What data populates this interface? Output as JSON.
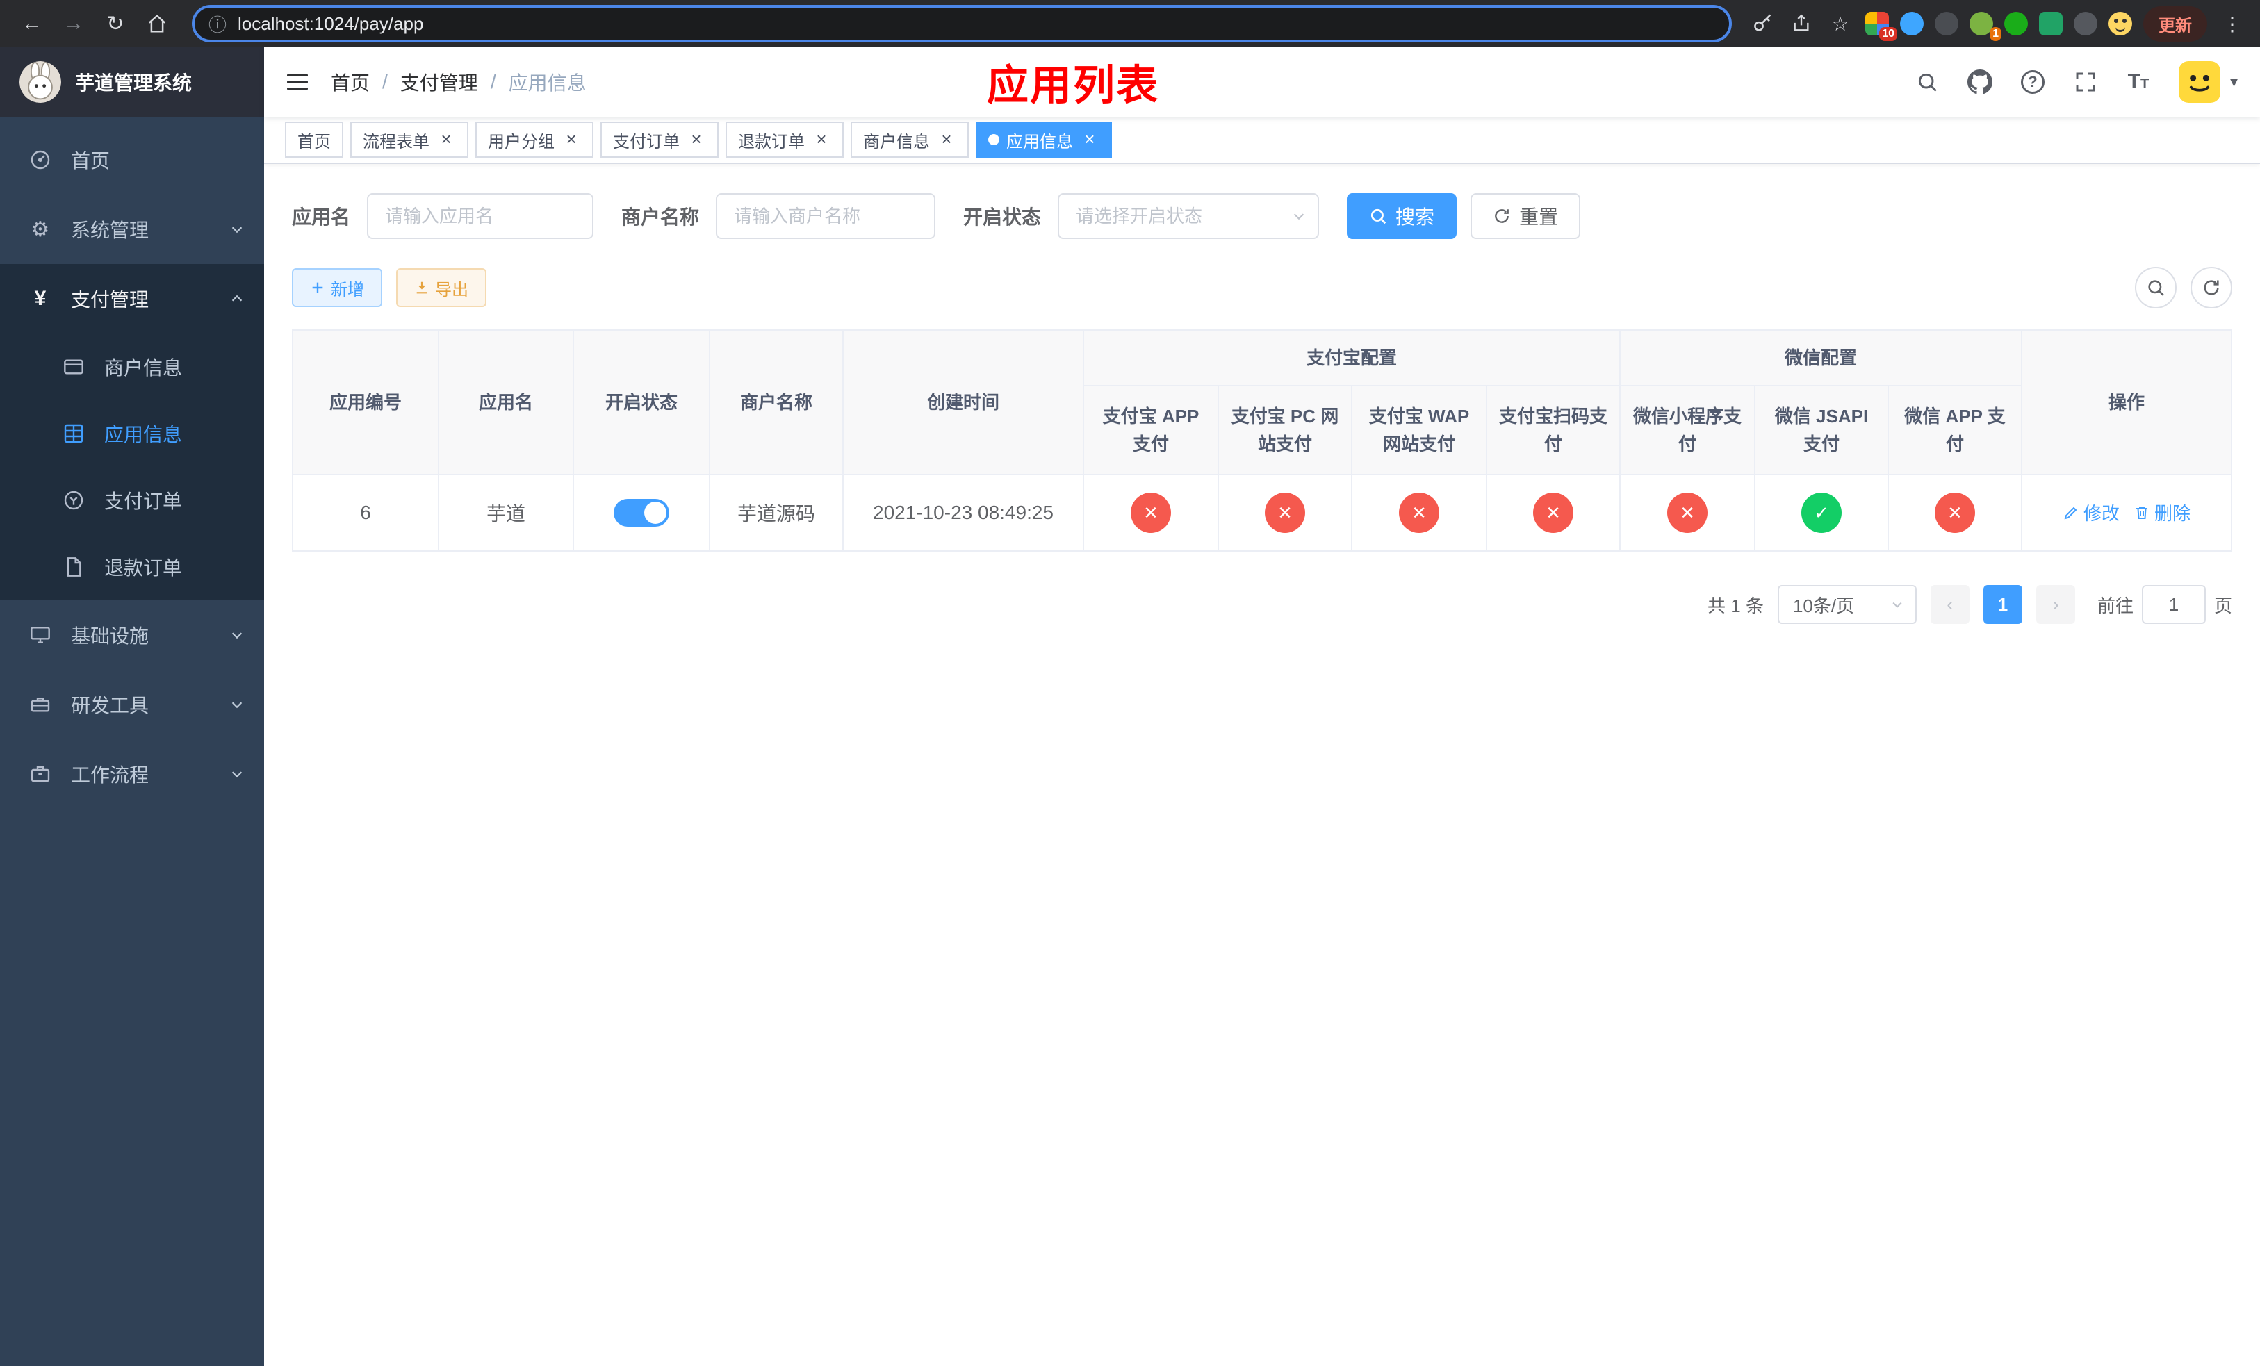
{
  "colors": {
    "primary": "#409eff",
    "danger": "#f5594e",
    "success": "#13ce66",
    "sidebar": "#304156",
    "submenu": "#1f2d3d"
  },
  "browser": {
    "url": "localhost:1024/pay/app",
    "update_label": "更新",
    "ext_badges": {
      "apps": "10",
      "avatar": "1"
    }
  },
  "icons": {
    "back": "←",
    "forward": "→",
    "reload": "↻",
    "info": "ⓘ",
    "star": "☆",
    "menu_dots": "⋮",
    "gear": "⚙",
    "yen": "¥",
    "caret_down": "▾",
    "prev": "‹",
    "next": "›",
    "cross": "✕",
    "check": "✓",
    "close": "×",
    "slash": "/"
  },
  "sidebar": {
    "title": "芋道管理系统",
    "items": [
      {
        "label": "首页"
      },
      {
        "label": "系统管理"
      },
      {
        "label": "支付管理",
        "open": true,
        "children": [
          {
            "label": "商户信息"
          },
          {
            "label": "应用信息",
            "active": true
          },
          {
            "label": "支付订单"
          },
          {
            "label": "退款订单"
          }
        ]
      },
      {
        "label": "基础设施"
      },
      {
        "label": "研发工具"
      },
      {
        "label": "工作流程"
      }
    ]
  },
  "header": {
    "breadcrumb": [
      "首页",
      "支付管理",
      "应用信息"
    ],
    "annotation": "应用列表"
  },
  "tabs": [
    {
      "label": "首页"
    },
    {
      "label": "流程表单"
    },
    {
      "label": "用户分组"
    },
    {
      "label": "支付订单"
    },
    {
      "label": "退款订单"
    },
    {
      "label": "商户信息"
    },
    {
      "label": "应用信息",
      "active": true
    }
  ],
  "filters": {
    "app_name_label": "应用名",
    "app_name_placeholder": "请输入应用名",
    "merchant_label": "商户名称",
    "merchant_placeholder": "请输入商户名称",
    "status_label": "开启状态",
    "status_placeholder": "请选择开启状态",
    "search_label": "搜索",
    "reset_label": "重置"
  },
  "toolbar": {
    "add_label": "新增",
    "export_label": "导出"
  },
  "table": {
    "group_headers": {
      "alipay": "支付宝配置",
      "wechat": "微信配置"
    },
    "headers": {
      "app_id": "应用编号",
      "app_name": "应用名",
      "status": "开启状态",
      "merchant": "商户名称",
      "created_at": "创建时间",
      "actions": "操作"
    },
    "sub_headers": [
      "支付宝 APP 支付",
      "支付宝 PC 网站支付",
      "支付宝 WAP 网站支付",
      "支付宝扫码支付",
      "微信小程序支付",
      "微信 JSAPI 支付",
      "微信 APP 支付"
    ],
    "rows": [
      {
        "app_id": "6",
        "app_name": "芋道",
        "status_on": true,
        "merchant": "芋道源码",
        "created_at": "2021-10-23 08:49:25",
        "configs": [
          "no",
          "no",
          "no",
          "no",
          "no",
          "yes",
          "no"
        ],
        "edit_label": "修改",
        "delete_label": "删除"
      }
    ]
  },
  "pagination": {
    "total_text": "共 1 条",
    "page_size_text": "10条/页",
    "current_page": "1",
    "goto_label": "前往",
    "goto_value": "1",
    "goto_unit": "页"
  }
}
